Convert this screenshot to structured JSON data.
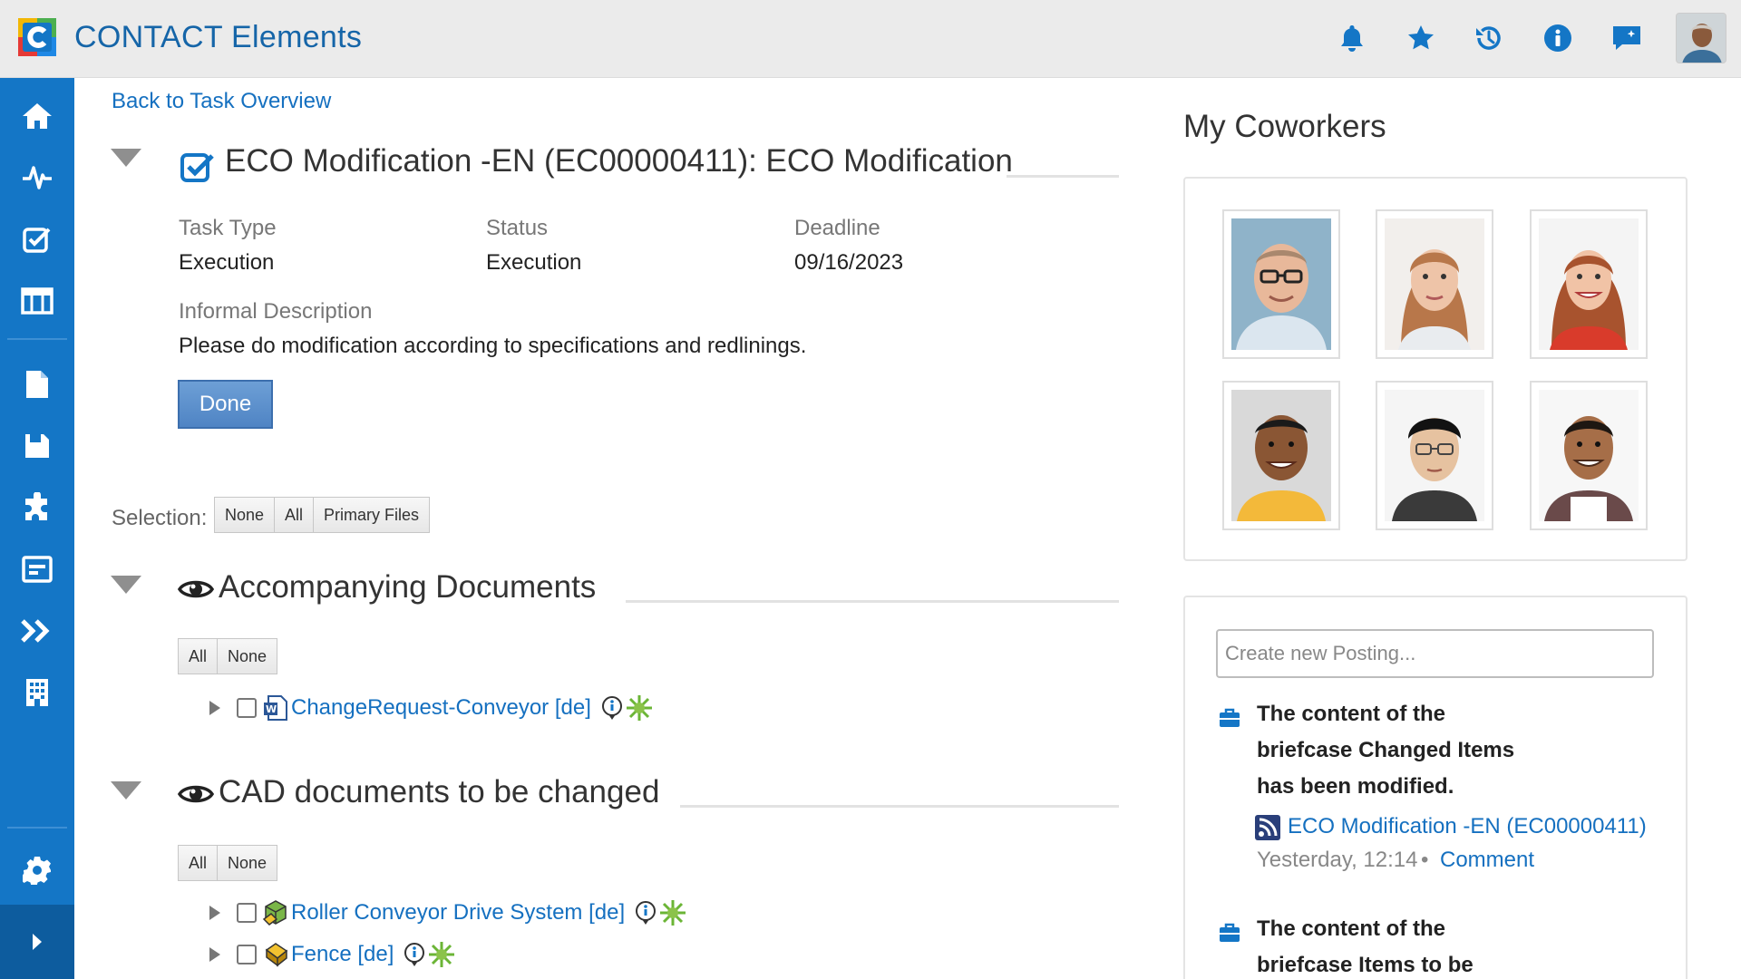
{
  "app": {
    "title": "CONTACT Elements"
  },
  "colors": {
    "brand_blue": "#1476c6",
    "link_blue": "#1570c0",
    "done_button": "#5b8fcd"
  },
  "header_icons": [
    "bell-icon",
    "star-icon",
    "history-icon",
    "info-icon",
    "chat-icon"
  ],
  "sidebar": {
    "items": [
      "home-icon",
      "activity-icon",
      "tasks-icon",
      "calendar-icon",
      "document-icon",
      "save-icon",
      "puzzle-icon",
      "dashboard-icon",
      "forward-icon",
      "building-icon"
    ],
    "footer": [
      "settings-icon",
      "expand-icon"
    ]
  },
  "task": {
    "back_link": "Back to Task Overview",
    "title": "ECO Modification -EN (EC00000411): ECO Modification",
    "fields": {
      "type_label": "Task Type",
      "type_value": "Execution",
      "status_label": "Status",
      "status_value": "Execution",
      "deadline_label": "Deadline",
      "deadline_value": "09/16/2023"
    },
    "description_label": "Informal Description",
    "description": "Please do modification according to specifications and redlinings.",
    "done_button": "Done"
  },
  "selection": {
    "label": "Selection:",
    "buttons": [
      "None",
      "All",
      "Primary Files"
    ]
  },
  "sections": [
    {
      "title": "Accompanying Documents",
      "buttons": [
        "All",
        "None"
      ],
      "items": [
        {
          "label": "ChangeRequest-Conveyor [de]",
          "icon": "word-doc-icon"
        }
      ]
    },
    {
      "title": "CAD documents to be changed",
      "buttons": [
        "All",
        "None"
      ],
      "items": [
        {
          "label": "Roller Conveyor Drive System [de]",
          "icon": "cad-assembly-icon"
        },
        {
          "label": "Fence [de]",
          "icon": "cad-part-icon"
        }
      ]
    }
  ],
  "coworkers": {
    "title": "My Coworkers",
    "count": 6
  },
  "activity": {
    "input_placeholder": "Create new Posting...",
    "posts": [
      {
        "lines": [
          "The content of the",
          "briefcase Changed Items",
          "has been modified."
        ],
        "link": "ECO Modification -EN (EC00000411)",
        "time": "Yesterday, 12:14",
        "separator": "•",
        "action": "Comment"
      },
      {
        "lines": [
          "The content of the",
          "briefcase Items to be"
        ]
      }
    ]
  }
}
